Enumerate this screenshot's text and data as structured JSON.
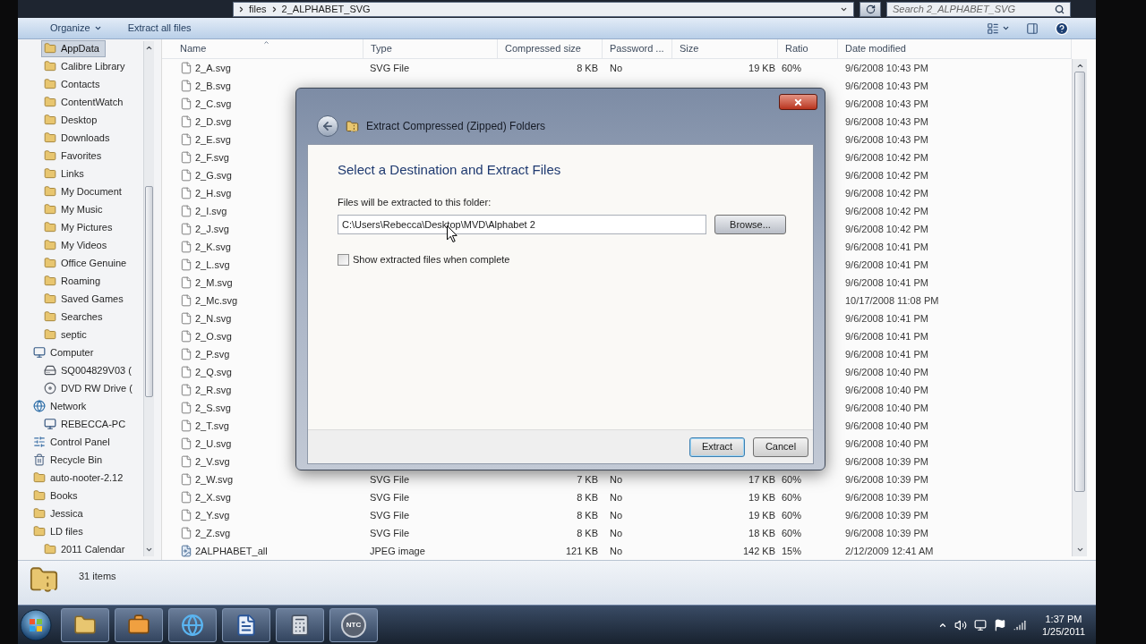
{
  "address_bar": {
    "breadcrumbs": [
      "files",
      "2_ALPHABET_SVG"
    ]
  },
  "search": {
    "placeholder": "Search 2_ALPHABET_SVG"
  },
  "toolbar": {
    "buttons": [
      {
        "label": "Organize",
        "kind": "menu"
      },
      {
        "label": "Extract all files",
        "kind": "action"
      }
    ]
  },
  "navigation": [
    {
      "children": [
        {
          "label": "AppData",
          "kind": "folder",
          "selected": true
        },
        {
          "label": "Calibre Library",
          "kind": "folder",
          "selected": false
        },
        {
          "label": "Contacts",
          "kind": "folder",
          "selected": false
        },
        {
          "label": "ContentWatch",
          "kind": "folder",
          "selected": false
        },
        {
          "label": "Desktop",
          "kind": "folder",
          "selected": false
        },
        {
          "label": "Downloads",
          "kind": "folder",
          "selected": false
        },
        {
          "label": "Favorites",
          "kind": "folder",
          "selected": false
        },
        {
          "label": "Links",
          "kind": "folder",
          "selected": false
        },
        {
          "label": "My Document",
          "kind": "folder",
          "selected": false
        },
        {
          "label": "My Music",
          "kind": "folder",
          "selected": false
        },
        {
          "label": "My Pictures",
          "kind": "folder",
          "selected": false
        },
        {
          "label": "My Videos",
          "kind": "folder",
          "selected": false
        },
        {
          "label": "Office Genuine",
          "kind": "folder",
          "selected": false
        },
        {
          "label": "Roaming",
          "kind": "folder",
          "selected": false
        },
        {
          "label": "Saved Games",
          "kind": "folder",
          "selected": false
        },
        {
          "label": "Searches",
          "kind": "folder",
          "selected": false
        },
        {
          "label": "septic",
          "kind": "folder",
          "selected": false
        }
      ]
    },
    {
      "label": "Computer",
      "kind": "computer",
      "selected": false,
      "children": [
        {
          "label": "SQ004829V03 (",
          "kind": "drive",
          "selected": false
        },
        {
          "label": "DVD RW Drive (",
          "kind": "optical_drive",
          "selected": false
        }
      ]
    },
    {
      "label": "Network",
      "kind": "network",
      "selected": false,
      "children": [
        {
          "label": "REBECCA-PC",
          "kind": "pc",
          "selected": false
        }
      ]
    },
    {
      "label": "Control Panel",
      "kind": "control_panel",
      "selected": false
    },
    {
      "label": "Recycle Bin",
      "kind": "recycle_bin",
      "selected": false
    },
    {
      "label": "auto-nooter-2.12",
      "kind": "folder",
      "selected": false
    },
    {
      "label": "Books",
      "kind": "folder",
      "selected": false
    },
    {
      "label": "Jessica",
      "kind": "folder",
      "selected": false
    },
    {
      "label": "LD files",
      "kind": "folder",
      "selected": false,
      "children": [
        {
          "label": "2011 Calendar",
          "kind": "folder",
          "selected": false
        }
      ]
    }
  ],
  "table": {
    "columns": [
      {
        "label": "Name",
        "sorted": true
      },
      {
        "label": "Type",
        "sorted": false
      },
      {
        "label": "Compressed size",
        "sorted": false
      },
      {
        "label": "Password ...",
        "sorted": false
      },
      {
        "label": "Size",
        "sorted": false
      },
      {
        "label": "Ratio",
        "sorted": false
      },
      {
        "label": "Date modified",
        "sorted": false
      }
    ],
    "rows": [
      {
        "name": "2_A.svg",
        "kind": "document",
        "type": "SVG File",
        "compressed_size": "8 KB",
        "password": "No",
        "size": "19 KB",
        "ratio": "60%",
        "date_modified": "9/6/2008 10:43 PM"
      },
      {
        "name": "2_B.svg",
        "kind": "document",
        "date_modified": "9/6/2008 10:43 PM"
      },
      {
        "name": "2_C.svg",
        "kind": "document",
        "date_modified": "9/6/2008 10:43 PM"
      },
      {
        "name": "2_D.svg",
        "kind": "document",
        "date_modified": "9/6/2008 10:43 PM"
      },
      {
        "name": "2_E.svg",
        "kind": "document",
        "date_modified": "9/6/2008 10:43 PM"
      },
      {
        "name": "2_F.svg",
        "kind": "document",
        "date_modified": "9/6/2008 10:42 PM"
      },
      {
        "name": "2_G.svg",
        "kind": "document",
        "date_modified": "9/6/2008 10:42 PM"
      },
      {
        "name": "2_H.svg",
        "kind": "document",
        "date_modified": "9/6/2008 10:42 PM"
      },
      {
        "name": "2_I.svg",
        "kind": "document",
        "date_modified": "9/6/2008 10:42 PM"
      },
      {
        "name": "2_J.svg",
        "kind": "document",
        "date_modified": "9/6/2008 10:42 PM"
      },
      {
        "name": "2_K.svg",
        "kind": "document",
        "date_modified": "9/6/2008 10:41 PM"
      },
      {
        "name": "2_L.svg",
        "kind": "document",
        "date_modified": "9/6/2008 10:41 PM"
      },
      {
        "name": "2_M.svg",
        "kind": "document",
        "date_modified": "9/6/2008 10:41 PM"
      },
      {
        "name": "2_Mc.svg",
        "kind": "document",
        "date_modified": "10/17/2008 11:08 PM"
      },
      {
        "name": "2_N.svg",
        "kind": "document",
        "date_modified": "9/6/2008 10:41 PM"
      },
      {
        "name": "2_O.svg",
        "kind": "document",
        "date_modified": "9/6/2008 10:41 PM"
      },
      {
        "name": "2_P.svg",
        "kind": "document",
        "date_modified": "9/6/2008 10:41 PM"
      },
      {
        "name": "2_Q.svg",
        "kind": "document",
        "date_modified": "9/6/2008 10:40 PM"
      },
      {
        "name": "2_R.svg",
        "kind": "document",
        "date_modified": "9/6/2008 10:40 PM"
      },
      {
        "name": "2_S.svg",
        "kind": "document",
        "date_modified": "9/6/2008 10:40 PM"
      },
      {
        "name": "2_T.svg",
        "kind": "document",
        "date_modified": "9/6/2008 10:40 PM"
      },
      {
        "name": "2_U.svg",
        "kind": "document",
        "date_modified": "9/6/2008 10:40 PM"
      },
      {
        "name": "2_V.svg",
        "kind": "document",
        "date_modified": "9/6/2008 10:39 PM"
      },
      {
        "name": "2_W.svg",
        "kind": "document",
        "type": "SVG File",
        "compressed_size": "7 KB",
        "password": "No",
        "size": "17 KB",
        "ratio": "60%",
        "date_modified": "9/6/2008 10:39 PM"
      },
      {
        "name": "2_X.svg",
        "kind": "document",
        "type": "SVG File",
        "compressed_size": "8 KB",
        "password": "No",
        "size": "19 KB",
        "ratio": "60%",
        "date_modified": "9/6/2008 10:39 PM"
      },
      {
        "name": "2_Y.svg",
        "kind": "document",
        "type": "SVG File",
        "compressed_size": "8 KB",
        "password": "No",
        "size": "19 KB",
        "ratio": "60%",
        "date_modified": "9/6/2008 10:39 PM"
      },
      {
        "name": "2_Z.svg",
        "kind": "document",
        "type": "SVG File",
        "compressed_size": "8 KB",
        "password": "No",
        "size": "18 KB",
        "ratio": "60%",
        "date_modified": "9/6/2008 10:39 PM"
      },
      {
        "name": "2ALPHABET_all",
        "kind": "image",
        "type": "JPEG image",
        "compressed_size": "121 KB",
        "password": "No",
        "size": "142 KB",
        "ratio": "15%",
        "date_modified": "2/12/2009 12:41 AM"
      }
    ]
  },
  "status_bar": {
    "item_count": "31 items"
  },
  "dialog": {
    "title": "Extract Compressed (Zipped) Folders",
    "heading": "Select a Destination and Extract Files",
    "folder_label": "Files will be extracted to this folder:",
    "folder_value": "C:\\Users\\Rebecca\\Desktop\\MVD\\Alphabet 2",
    "browse_button": "Browse...",
    "show_files": {
      "label": "Show extracted files when complete",
      "checked": false
    },
    "buttons": [
      {
        "label": "Extract",
        "default": true
      },
      {
        "label": "Cancel",
        "default": false
      }
    ]
  },
  "taskbar": {
    "logo_text": "NTC",
    "clock": {
      "time": "1:37 PM",
      "date": "1/25/2011"
    }
  }
}
